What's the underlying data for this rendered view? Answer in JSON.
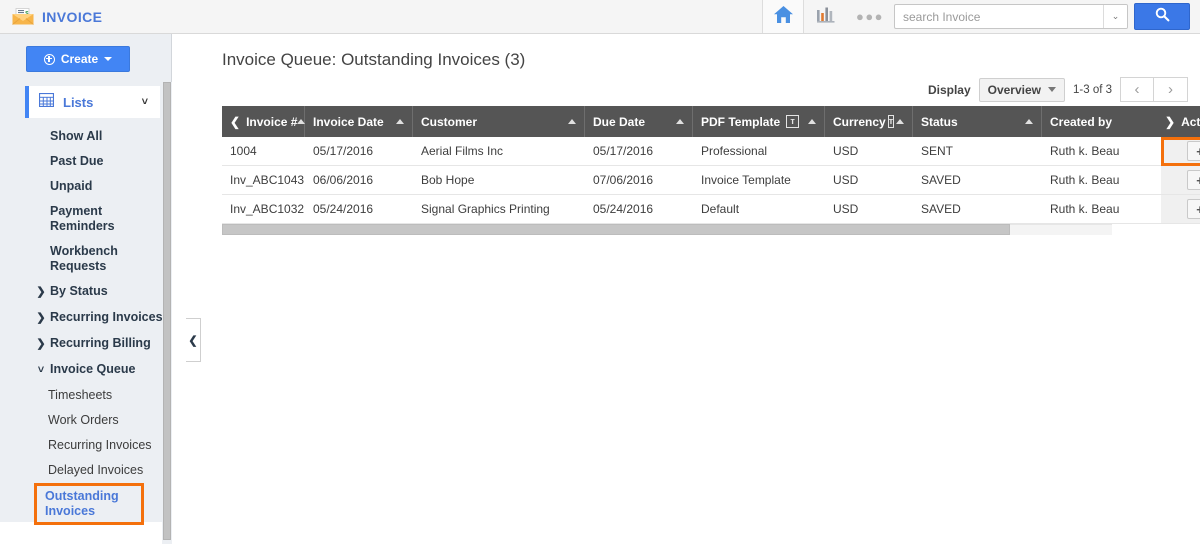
{
  "app": {
    "title": "INVOICE",
    "logo_icon": "envelope-invoice-icon"
  },
  "topbar": {
    "home_icon": "home-icon",
    "reports_icon": "bar-chart-icon",
    "more_icon": "more-dots-icon",
    "more_glyph": "●●●",
    "search": {
      "placeholder": "search Invoice",
      "value": "",
      "dropdown_icon": "chevron-down-icon",
      "dropdown_glyph": "⌄",
      "button_icon": "search-icon"
    }
  },
  "sidebar": {
    "create_button": {
      "label": "Create",
      "plus_icon": "plus-circle-icon",
      "caret_icon": "caret-down-icon"
    },
    "lists": {
      "label": "Lists",
      "icon": "grid-icon",
      "chevron": "˅"
    },
    "items": [
      {
        "label": "Show All",
        "type": "link",
        "arrow": ""
      },
      {
        "label": "Past Due",
        "type": "link",
        "arrow": ""
      },
      {
        "label": "Unpaid",
        "type": "link",
        "arrow": ""
      },
      {
        "label": "Payment Reminders",
        "type": "link",
        "arrow": ""
      },
      {
        "label": "Workbench Requests",
        "type": "link",
        "arrow": ""
      },
      {
        "label": "By Status",
        "type": "group",
        "arrow": "❯"
      },
      {
        "label": "Recurring Invoices",
        "type": "group",
        "arrow": "❯"
      },
      {
        "label": "Recurring Billing",
        "type": "group",
        "arrow": "❯"
      },
      {
        "label": "Invoice Queue",
        "type": "group-open",
        "arrow": "˅"
      },
      {
        "label": "Timesheets",
        "type": "sub",
        "arrow": ""
      },
      {
        "label": "Work Orders",
        "type": "sub",
        "arrow": ""
      },
      {
        "label": "Recurring Invoices",
        "type": "sub",
        "arrow": ""
      },
      {
        "label": "Delayed Invoices",
        "type": "sub",
        "arrow": ""
      },
      {
        "label": "Outstanding Invoices",
        "type": "sub-selected",
        "arrow": ""
      }
    ],
    "collapse_handle_icon": "chevron-left-icon",
    "collapse_handle_glyph": "❮"
  },
  "main": {
    "page_title": "Invoice Queue: Outstanding Invoices (3)",
    "display": {
      "label": "Display",
      "selected": "Overview",
      "caret_icon": "caret-down-icon",
      "range": "1-3 of 3",
      "prev_glyph": "‹",
      "next_glyph": "›"
    },
    "table": {
      "columns": [
        {
          "label": "Invoice #",
          "sortable": true,
          "sort": "asc",
          "filter": false,
          "prev_chevron": "❮"
        },
        {
          "label": "Invoice Date",
          "sortable": true,
          "sort": "asc",
          "filter": false
        },
        {
          "label": "Customer",
          "sortable": true,
          "sort": "asc",
          "filter": false
        },
        {
          "label": "Due Date",
          "sortable": true,
          "sort": "asc",
          "filter": false
        },
        {
          "label": "PDF Template",
          "sortable": true,
          "sort": "asc",
          "filter": true,
          "filter_glyph": "ᴛ"
        },
        {
          "label": "Currency",
          "sortable": true,
          "sort": "asc",
          "filter": true,
          "filter_glyph": "ᴛ"
        },
        {
          "label": "Status",
          "sortable": true,
          "sort": "asc",
          "filter": false
        },
        {
          "label": "Created by",
          "sortable": false,
          "sort": "",
          "filter": false
        }
      ],
      "actions_column": {
        "label": "Actions",
        "chevron": "❯",
        "add_icon": "plus-icon",
        "add_glyph": "+"
      },
      "rows": [
        {
          "invoice_number": "1004",
          "invoice_date": "05/17/2016",
          "customer": "Aerial Films Inc",
          "due_date": "05/17/2016",
          "pdf_template": "Professional",
          "currency": "USD",
          "status": "SENT",
          "created_by": "Ruth k. Beau",
          "action_focused": true
        },
        {
          "invoice_number": "Inv_ABC1043",
          "invoice_date": "06/06/2016",
          "customer": "Bob Hope",
          "due_date": "07/06/2016",
          "pdf_template": "Invoice Template",
          "currency": "USD",
          "status": "SAVED",
          "created_by": "Ruth k. Beau",
          "action_focused": false
        },
        {
          "invoice_number": "Inv_ABC1032",
          "invoice_date": "05/24/2016",
          "customer": "Signal Graphics Printing",
          "due_date": "05/24/2016",
          "pdf_template": "Default",
          "currency": "USD",
          "status": "SAVED",
          "created_by": "Ruth k. Beau",
          "action_focused": false
        }
      ]
    }
  },
  "colors": {
    "brand_blue": "#4a78d8",
    "create_blue": "#4285f4",
    "header_gray": "#555555",
    "highlight_orange": "#f4700c",
    "sidebar_bg": "#eceff3",
    "search_button": "#3b78e7"
  }
}
